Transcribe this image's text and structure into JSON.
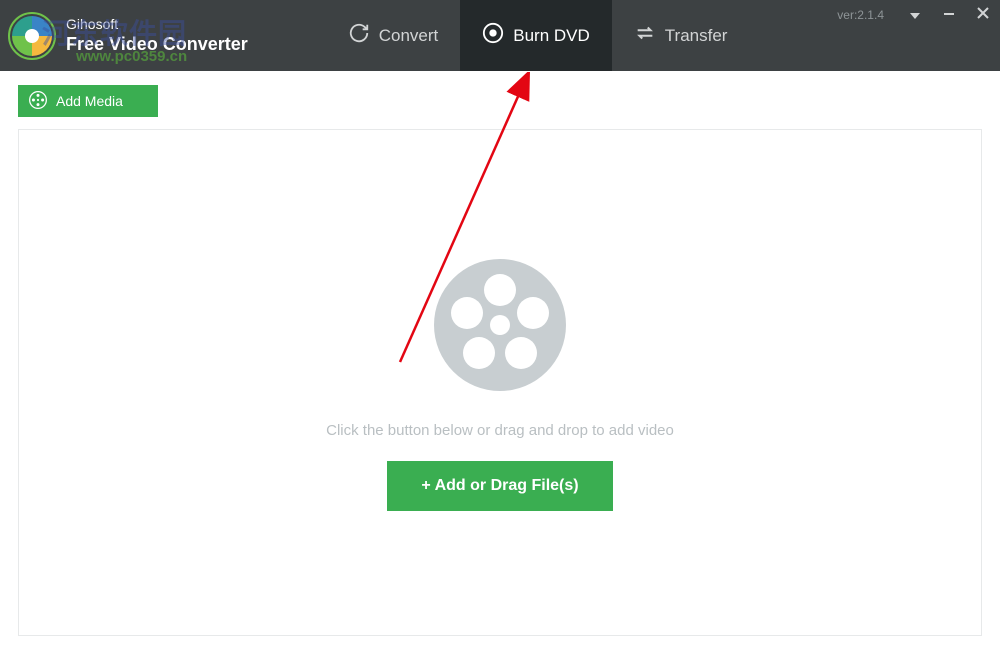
{
  "header": {
    "brand_name": "Gihosoft",
    "brand_sub": "Free Video Converter",
    "version": "ver:2.1.4"
  },
  "tabs": {
    "convert": "Convert",
    "burn_dvd": "Burn DVD",
    "transfer": "Transfer"
  },
  "toolbar": {
    "add_media": "Add Media"
  },
  "dropzone": {
    "hint": "Click the button below or drag and drop to add video",
    "add_button": "+ Add or Drag File(s)"
  },
  "watermark": {
    "main": "河东软件园",
    "sub": "www.pc0359.cn"
  }
}
